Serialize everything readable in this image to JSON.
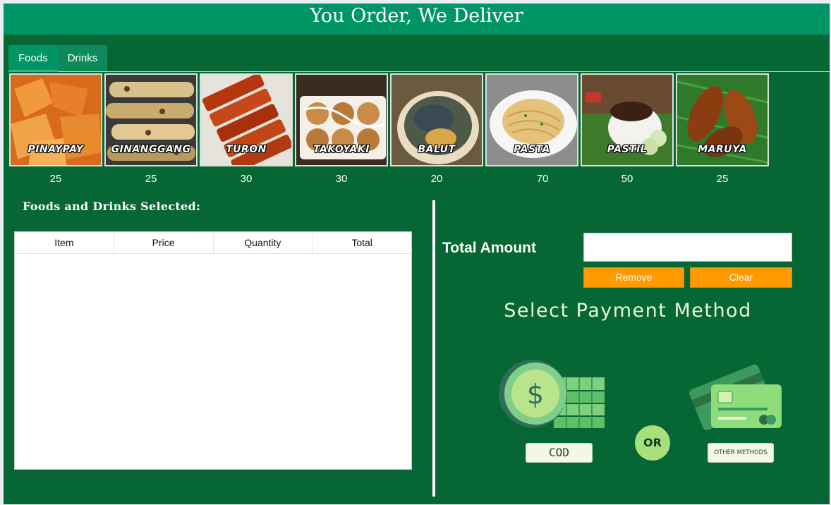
{
  "app": {
    "title": "You Order, We Deliver"
  },
  "tabs": [
    {
      "label": "Foods",
      "active": true
    },
    {
      "label": "Drinks",
      "active": false
    }
  ],
  "foods": [
    {
      "name": "PINAYPAY",
      "price": "25"
    },
    {
      "name": "GINANGGANG",
      "price": "25"
    },
    {
      "name": "TURON",
      "price": "30"
    },
    {
      "name": "TAKOYAKI",
      "price": "30"
    },
    {
      "name": "BALUT",
      "price": "20"
    },
    {
      "name": "PASTA",
      "price": "70"
    },
    {
      "name": "PASTIL",
      "price": "50"
    },
    {
      "name": "MARUYA",
      "price": "25"
    }
  ],
  "selection": {
    "title": "Foods and Drinks Selected:",
    "columns": [
      "Item",
      "Price",
      "Quantity",
      "Total"
    ],
    "rows": []
  },
  "summary": {
    "total_label": "Total Amount",
    "total_value": "",
    "remove_label": "Remove",
    "clear_label": "Clear"
  },
  "payment": {
    "title": "Select Payment Method",
    "cod_label": "COD",
    "or_label": "OR",
    "other_label": "OTHER METHODS",
    "cod_icon": "cash-coins-icon",
    "other_icon": "credit-card-icon"
  },
  "colors": {
    "header": "#009565",
    "background": "#066734",
    "button": "#ff9a00",
    "tab": "#0d8a5c"
  }
}
